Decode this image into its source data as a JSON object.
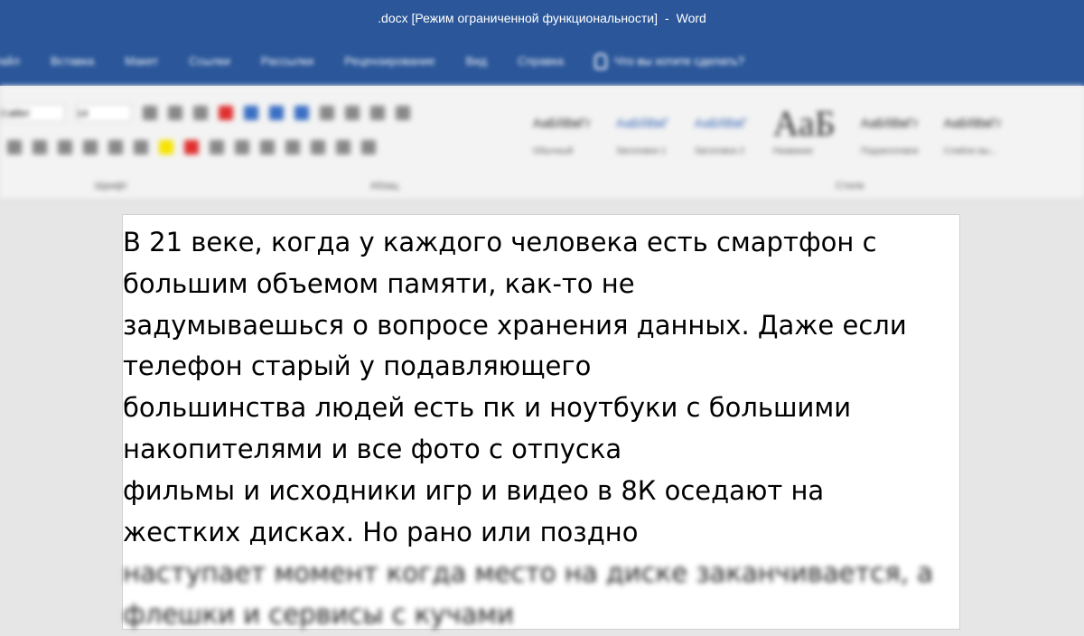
{
  "window": {
    "document_title": ".docx [Режим ограниченной функциональности]",
    "separator": "-",
    "app_name": "Word"
  },
  "menu": {
    "tabs": [
      "Файл",
      "Вставка",
      "Макет",
      "Ссылки",
      "Рассылки",
      "Рецензирование",
      "Вид",
      "Справка"
    ],
    "tell_me": "Что вы хотите сделать?"
  },
  "ribbon": {
    "font_name": "Calibri",
    "font_size": "14",
    "styles": [
      {
        "sample": "АаБбВвГг",
        "caption": "Обычный"
      },
      {
        "sample": "АаБбВвГ",
        "caption": "Заголовок 1"
      },
      {
        "sample": "АаБбВвГ",
        "caption": "Заголовок 2"
      },
      {
        "sample": "АаБ",
        "caption": "Название"
      },
      {
        "sample": "АаБбВвГг",
        "caption": "Подзаголовок"
      },
      {
        "sample": "АаБбВвГг",
        "caption": "Слабое вы..."
      }
    ],
    "groups": [
      "Шрифт",
      "Абзац",
      "Стили"
    ]
  },
  "document": {
    "lines": [
      "В 21 веке, когда у каждого человека есть смартфон с",
      "большим объемом памяти, как-то не",
      "задумываешься о вопросе хранения данных. Даже если",
      "телефон старый у подавляющего",
      "большинства людей есть пк и ноутбуки с большими",
      "накопителями и все фото с отпуска",
      "фильмы и исходники игр и видео в 8К оседают на",
      "жестких дисках. Но рано или поздно",
      "наступает момент когда место на диске заканчивается, а",
      "флешки и сервисы с кучами"
    ]
  }
}
